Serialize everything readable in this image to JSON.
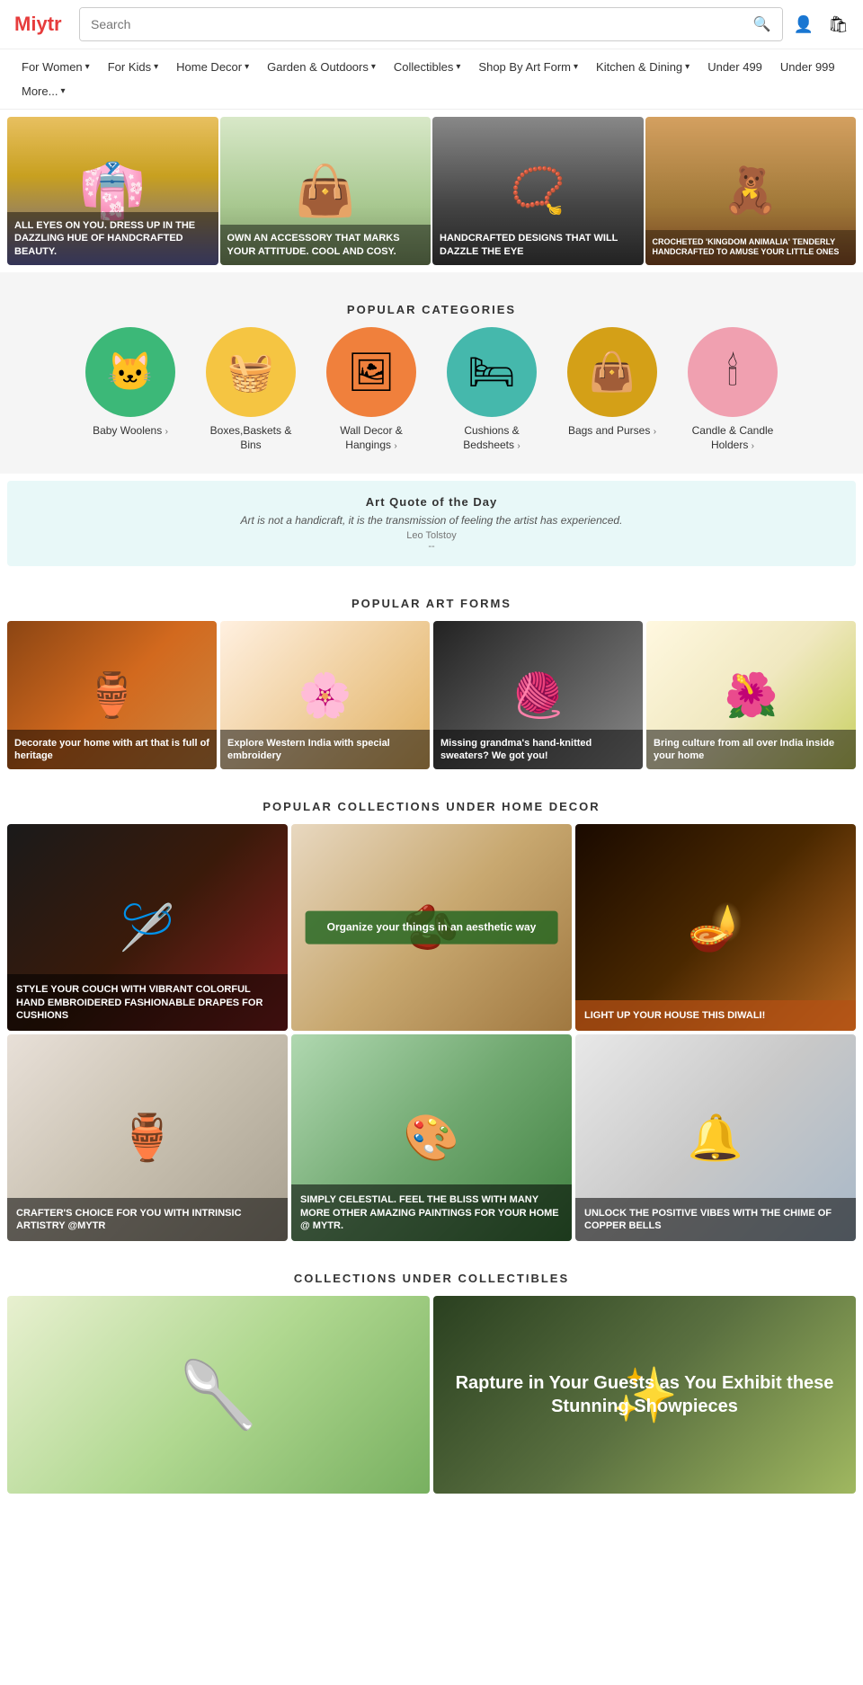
{
  "header": {
    "logo": "Mytr",
    "search_placeholder": "Search",
    "search_button_icon": "🔍",
    "account_icon": "👤",
    "cart_icon": "🛍"
  },
  "nav": {
    "items": [
      {
        "label": "For Women",
        "has_dropdown": true
      },
      {
        "label": "For Kids",
        "has_dropdown": true
      },
      {
        "label": "Home Decor",
        "has_dropdown": true
      },
      {
        "label": "Garden & Outdoors",
        "has_dropdown": true
      },
      {
        "label": "Collectibles",
        "has_dropdown": true
      },
      {
        "label": "Shop By Art Form",
        "has_dropdown": true
      },
      {
        "label": "Kitchen & Dining",
        "has_dropdown": true
      },
      {
        "label": "Under 499",
        "has_dropdown": false
      },
      {
        "label": "Under 999",
        "has_dropdown": false
      },
      {
        "label": "More...",
        "has_dropdown": true
      }
    ]
  },
  "hero_banners": [
    {
      "id": "banner-1",
      "text": "ALL EYES ON YOU. DRESS UP IN THE DAZZLING HUE OF HANDCRAFTED BEAUTY.",
      "emoji": "👘"
    },
    {
      "id": "banner-2",
      "text": "OWN AN ACCESSORY THAT MARKS YOUR ATTITUDE. COOL AND COSY.",
      "emoji": "👜"
    },
    {
      "id": "banner-3",
      "text": "Handcrafted designs that will dazzle the eye",
      "emoji": "📿"
    },
    {
      "id": "banner-4",
      "text": "CROCHETED 'KINGDOM ANIMALIA' TENDERLY HANDCRAFTED TO AMUSE YOUR LITTLE ONES",
      "emoji": "🧸"
    }
  ],
  "popular_categories": {
    "title": "POPULAR CATEGORIES",
    "items": [
      {
        "label": "Baby Woolens",
        "arrow": "›",
        "emoji": "🐱",
        "color": "cat-green"
      },
      {
        "label": "Boxes,Baskets & Bins",
        "arrow": "",
        "emoji": "🧺",
        "color": "cat-yellow"
      },
      {
        "label": "Wall Decor & Hangings",
        "arrow": "›",
        "emoji": "🖼",
        "color": "cat-orange"
      },
      {
        "label": "Cushions & Bedsheets",
        "arrow": "›",
        "emoji": "🛏",
        "color": "cat-teal"
      },
      {
        "label": "Bags and Purses",
        "arrow": "›",
        "emoji": "👜",
        "color": "cat-gold"
      },
      {
        "label": "Candle & Candle Holders",
        "arrow": "›",
        "emoji": "🕯",
        "color": "cat-pink"
      }
    ]
  },
  "art_quote": {
    "title": "Art Quote of the Day",
    "text": "Art is not a handicraft, it is the transmission of feeling the artist has experienced.",
    "author": "Leo Tolstoy",
    "dash": "--"
  },
  "popular_art_forms": {
    "title": "POPULAR ART FORMS",
    "items": [
      {
        "id": "art-1",
        "text": "Decorate your home with art that is full of heritage",
        "emoji": "🏺"
      },
      {
        "id": "art-2",
        "text": "Explore Western India with special embroidery",
        "emoji": "🌸"
      },
      {
        "id": "art-3",
        "text": "Missing grandma's hand-knitted sweaters? We got you!",
        "emoji": "🧶"
      },
      {
        "id": "art-4",
        "text": "Bring culture from all over India inside your home",
        "emoji": "🌺"
      }
    ]
  },
  "collections_home_decor": {
    "title": "POPULAR COLLECTIONS UNDER HOME DECOR",
    "top_items": [
      {
        "id": "coll-1",
        "text": "STYLE YOUR COUCH WITH VIBRANT COLORFUL HAND EMBROIDERED FASHIONABLE DRAPES FOR CUSHIONS",
        "emoji": "🪡"
      },
      {
        "id": "coll-2",
        "text": "Organize your things in an aesthetic way",
        "emoji": "🫘"
      },
      {
        "id": "coll-3",
        "text": "Light up your house this Diwali!",
        "emoji": "🪔"
      }
    ],
    "bottom_items": [
      {
        "id": "coll-4",
        "text": "CRAFTER'S CHOICE FOR YOU WITH INTRINSIC ARTISTRY @MYTR",
        "emoji": "🏺"
      },
      {
        "id": "coll-5",
        "text": "SIMPLY CELESTIAL. FEEL THE BLISS WITH MANY MORE OTHER AMAZING PAINTINGS FOR YOUR HOME @ MYTR.",
        "emoji": "🎨"
      },
      {
        "id": "coll-6",
        "text": "Unlock the positive vibes with the chime of Copper bells",
        "emoji": "🔔"
      }
    ]
  },
  "collections_collectibles": {
    "title": "COLLECTIONS UNDER COLLECTIBLES",
    "items": [
      {
        "id": "col-c1",
        "text": "",
        "emoji": "🥄"
      },
      {
        "id": "col-c2",
        "text": "Rapture in Your Guests as You Exhibit these Stunning Showpieces",
        "emoji": "✨"
      }
    ]
  }
}
